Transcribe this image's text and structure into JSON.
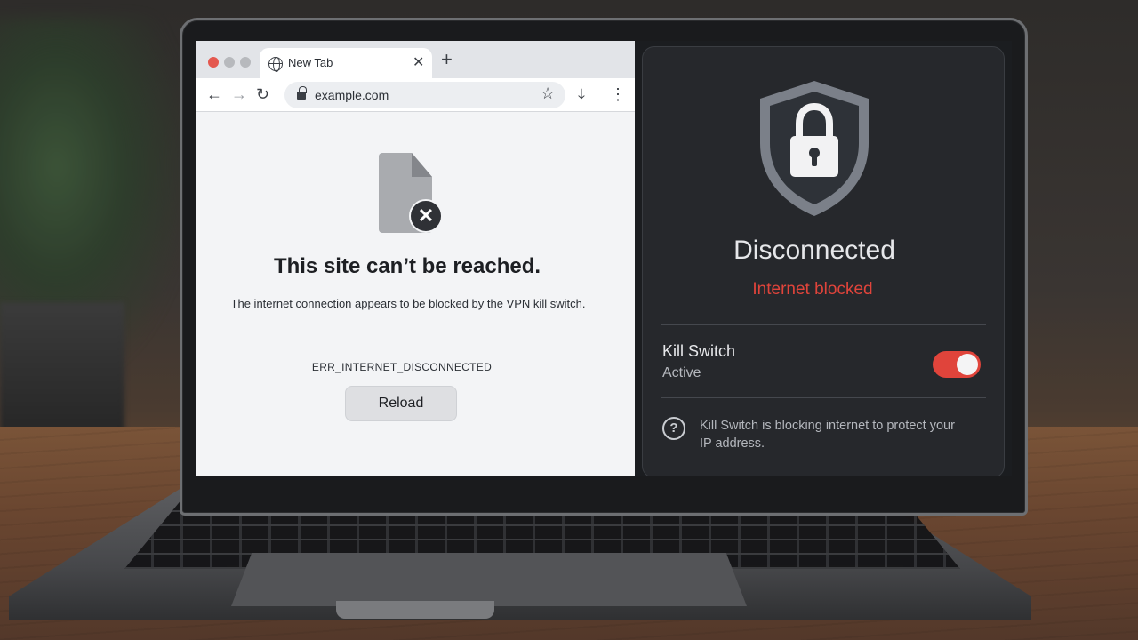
{
  "colors": {
    "accent_red": "#e0443b",
    "panel_bg": "#26282c",
    "browser_bg": "#f3f4f6",
    "traffic_light_red": "#e4584f",
    "traffic_light_gray": "#b7b9bd"
  },
  "browser": {
    "tab": {
      "title": "New Tab",
      "icon": "globe-icon",
      "close_glyph": "✕"
    },
    "new_tab_glyph": "+",
    "toolbar": {
      "back_glyph": "←",
      "forward_glyph": "→",
      "reload_glyph": "↻",
      "url": "example.com",
      "star_glyph": "☆",
      "download_glyph": "⤓",
      "menu_glyph": "⋮"
    },
    "error_page": {
      "title": "This site can’t be reached.",
      "description": "The internet connection appears to be blocked by the VPN kill switch.",
      "error_code": "ERR_INTERNET_DISCONNECTED",
      "reload_label": "Reload",
      "badge_glyph": "✕"
    }
  },
  "vpn": {
    "status": "Disconnected",
    "substatus": "Internet blocked",
    "kill_switch": {
      "title": "Kill Switch",
      "state": "Active",
      "enabled": true
    },
    "help_glyph": "?",
    "info_text": "Kill Switch is blocking internet to protect your IP address."
  }
}
